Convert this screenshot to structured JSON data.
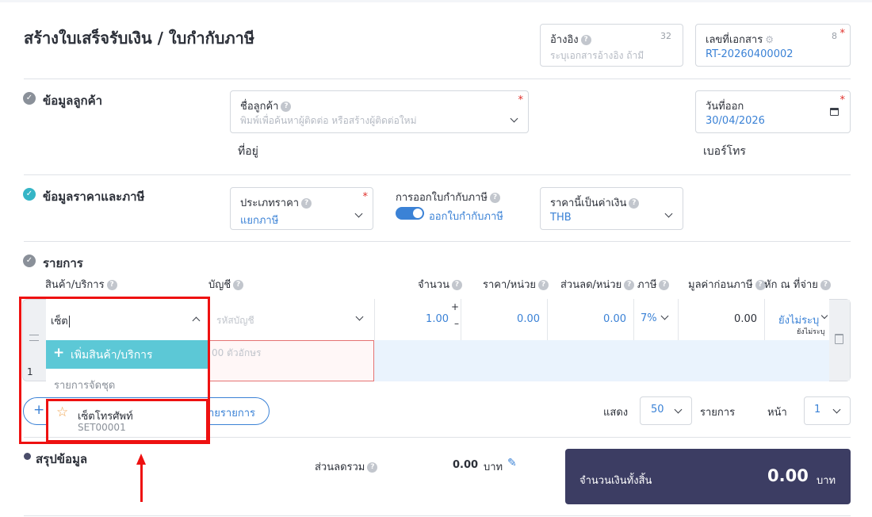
{
  "page": {
    "title": "สร้างใบเสร็จรับเงิน / ใบกำกับภาษี"
  },
  "reference": {
    "label": "อ้างอิง",
    "placeholder": "ระบุเอกสารอ้างอิง ถ้ามี",
    "counter": "32"
  },
  "doc_number": {
    "label": "เลขที่เอกสาร",
    "value": "RT-20260400002",
    "counter": "8"
  },
  "customer_section": {
    "title": "ข้อมูลลูกค้า",
    "customer_label": "ชื่อลูกค้า",
    "customer_placeholder": "พิมพ์เพื่อค้นหาผู้ติดต่อ หรือสร้างผู้ติดต่อใหม่",
    "address_label": "ที่อยู่",
    "issue_date_label": "วันที่ออก",
    "issue_date_value": "30/04/2026",
    "phone_label": "เบอร์โทร"
  },
  "price_section": {
    "title": "ข้อมูลราคาและภาษี",
    "price_type_label": "ประเภทราคา",
    "price_type_value": "แยกภาษี",
    "tax_invoice_label": "การออกใบกำกับภาษี",
    "tax_invoice_toggle_text": "ออกใบกำกับภาษี",
    "currency_label": "ราคานี้เป็นค่าเงิน",
    "currency_value": "THB"
  },
  "items_section": {
    "title": "รายการ",
    "columns": [
      "สินค้า/บริการ",
      "บัญชี",
      "จำนวน",
      "ราคา/หน่วย",
      "ส่วนลด/หน่วย",
      "ภาษี",
      "มูลค่าก่อนภาษี",
      "หัก ณ ที่จ่าย"
    ],
    "row": {
      "index": "1",
      "product_input": "เซ็ต",
      "account_placeholder": "รหัสบัญชี",
      "description_placeholder": "00 ตัวอักษร",
      "quantity": "1.00",
      "unit_price": "0.00",
      "discount": "0.00",
      "tax": "7%",
      "pre_tax": "0.00",
      "withholding": "ยังไม่ระบุ",
      "withholding_sub": "ยังไม่ระบุ"
    },
    "dropdown": {
      "add_label": "เพิ่มสินค้า/บริการ",
      "group_label": "รายการจัดชุด",
      "option_name": "เซ็ตโทรศัพท์",
      "option_code": "SET00001"
    },
    "add_line_button_partial": "ายรายการ",
    "show_label": "แสดง",
    "page_size": "50",
    "rows_label": "รายการ",
    "page_label": "หน้า",
    "page_value": "1"
  },
  "summary": {
    "title": "สรุปข้อมูล",
    "discount_label": "ส่วนลดรวม",
    "discount_value": "0.00",
    "currency_unit": "บาท",
    "total_label": "จำนวนเงินทั้งสิ้น",
    "total_value": "0.00",
    "total_unit": "บาท"
  },
  "colors": {
    "accent": "#3b82d6",
    "teal": "#5cc8d6",
    "annotation_red": "#ee1111",
    "total_bg": "#3c3d63"
  }
}
